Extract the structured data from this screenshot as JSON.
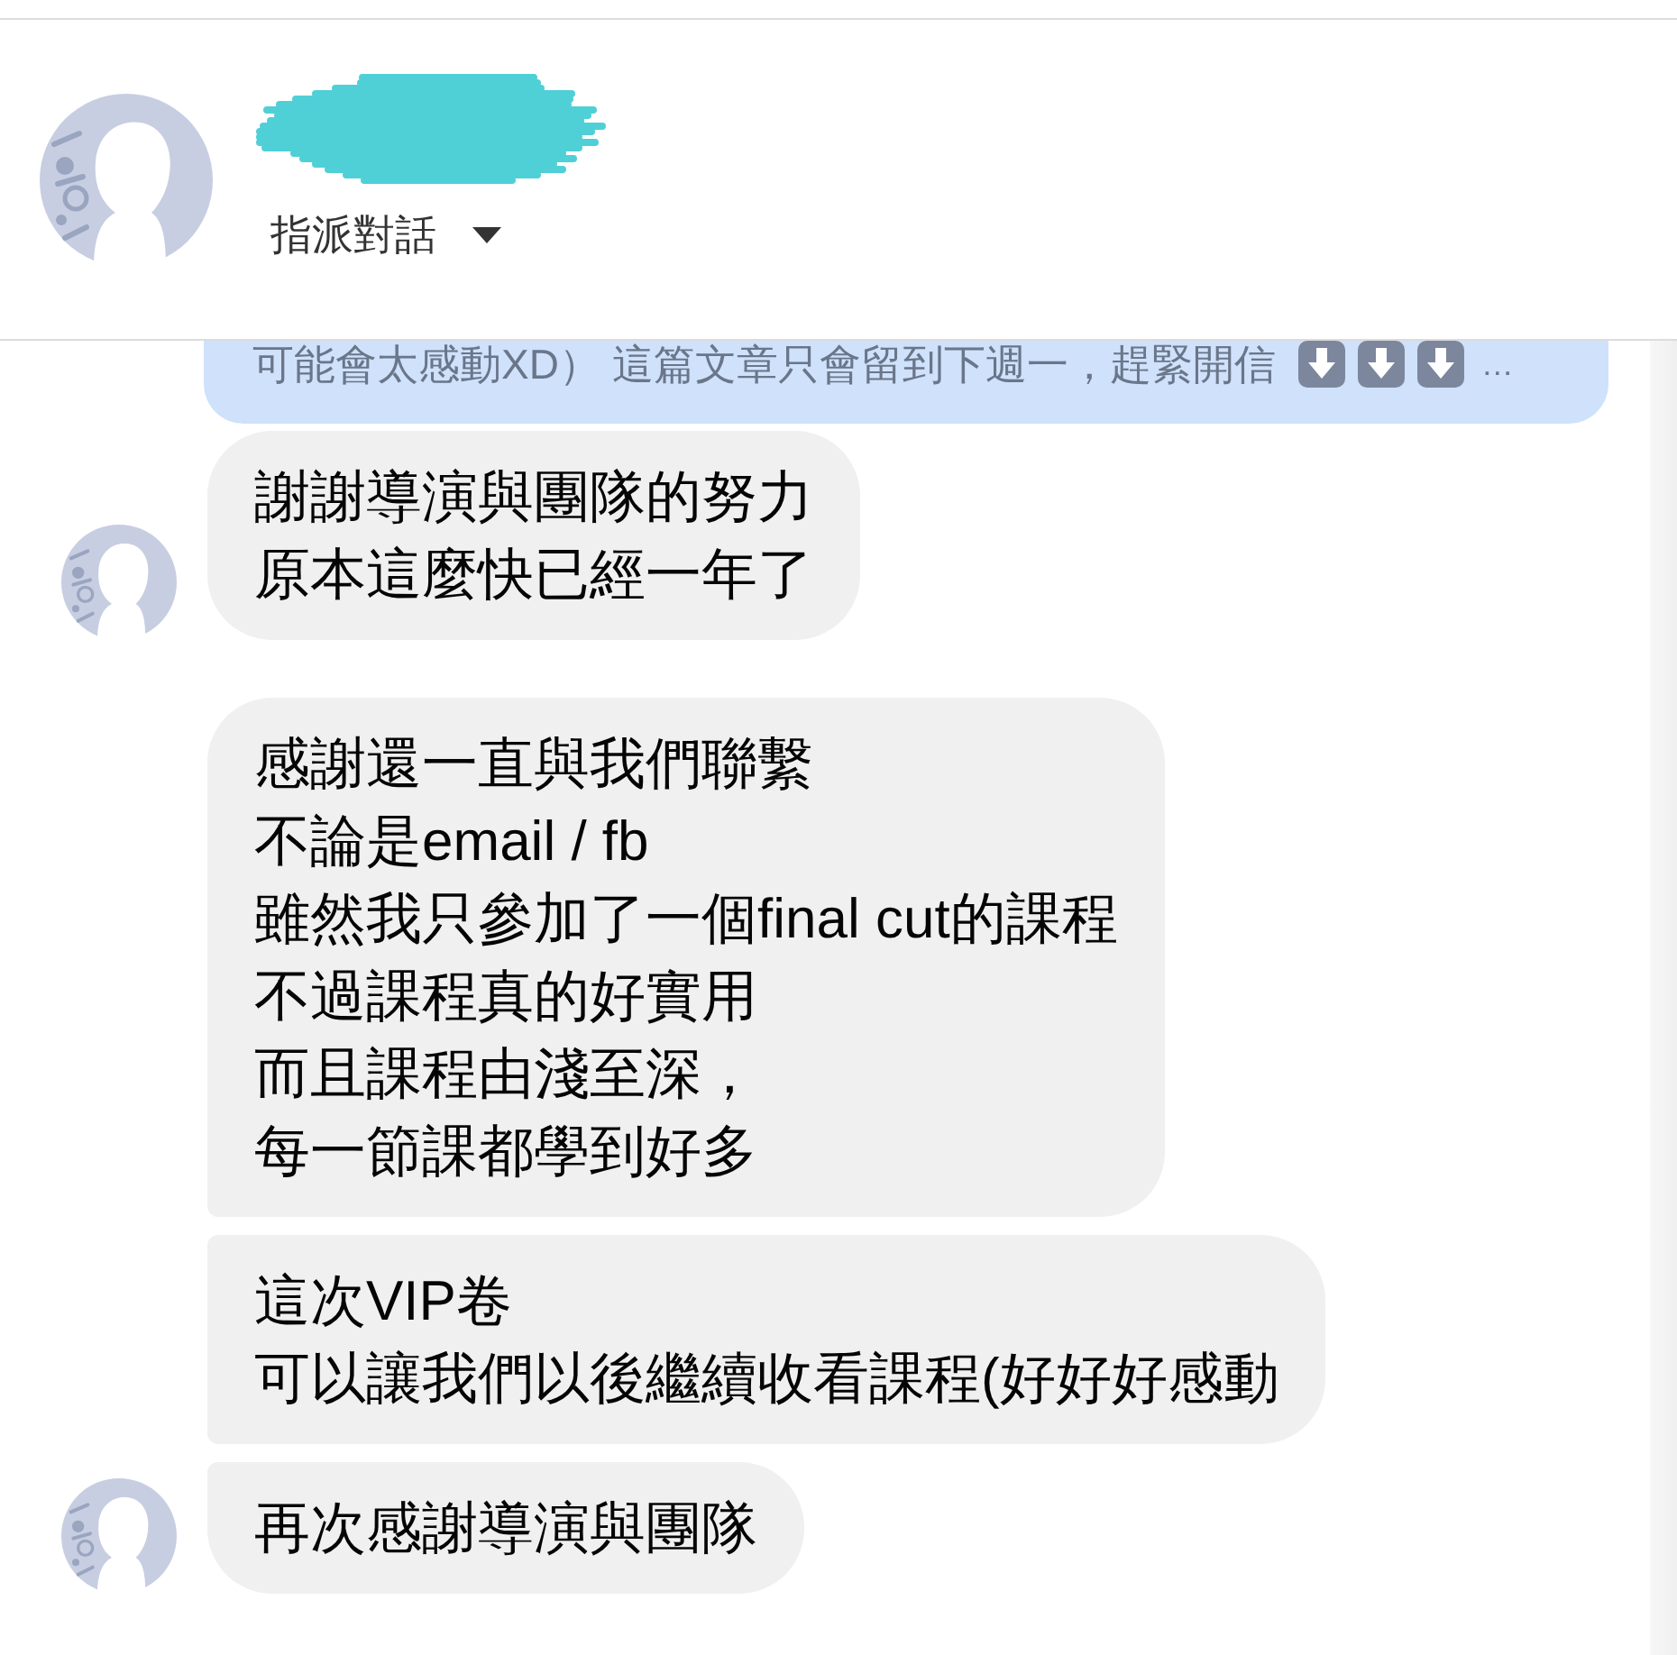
{
  "header": {
    "name_redacted": true,
    "assign_menu": {
      "label": "指派對話"
    }
  },
  "conversation": {
    "preview": {
      "text": "可能會太感動XD） 這篇文章只會留到下週一，趕緊開信",
      "ellipsis": "…"
    },
    "groups": [
      {
        "bubbles": [
          {
            "lines": [
              "謝謝導演與團隊的努力",
              "原本這麼快已經一年了"
            ]
          }
        ]
      },
      {
        "bubbles": [
          {
            "lines": [
              "感謝還一直與我們聯繫",
              "不論是email / fb",
              "雖然我只參加了一個final cut的課程",
              "不過課程真的好實用",
              "而且課程由淺至深，",
              "每一節課都學到好多"
            ]
          },
          {
            "lines": [
              "這次VIP卷",
              "可以讓我們以後繼續收看課程(好好好感動"
            ]
          },
          {
            "lines": [
              "再次感謝導演與團隊"
            ]
          }
        ]
      }
    ]
  }
}
